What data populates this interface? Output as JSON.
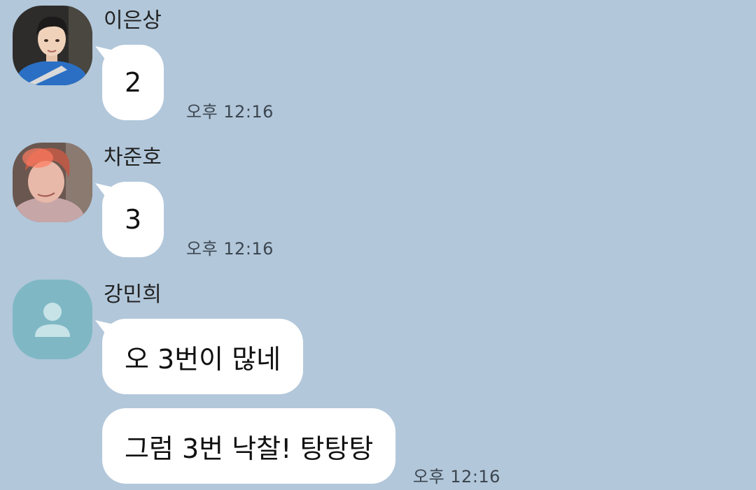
{
  "messages": [
    {
      "sender": "이은상",
      "avatar_icon": "profile-photo",
      "bubbles": [
        "2"
      ],
      "time": "오후 12:16"
    },
    {
      "sender": "차준호",
      "avatar_icon": "profile-photo",
      "bubbles": [
        "3"
      ],
      "time": "오후 12:16"
    },
    {
      "sender": "강민희",
      "avatar_icon": "default-person-icon",
      "bubbles": [
        "오 3번이 많네",
        "그럼 3번 낙찰! 탕탕탕"
      ],
      "time": "오후 12:16"
    }
  ],
  "colors": {
    "background": "#b2c7da",
    "bubble": "#ffffff",
    "default_avatar": "#7fb8c4"
  }
}
